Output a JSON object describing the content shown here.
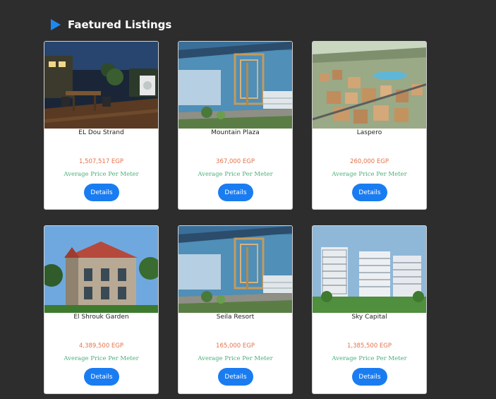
{
  "header": {
    "title": "Faetured Listings",
    "icon": "play-triangle-icon",
    "accent": "#1e88f0"
  },
  "colors": {
    "price": "#e4734a",
    "avg": "#4cae7a",
    "button": "#1a7cf1",
    "background": "#2d2d2d"
  },
  "listings": [
    {
      "name": "EL Dou Strand",
      "price": "1,507,517 EGP",
      "avg_label": "Average Price Per Meter",
      "button": "Details"
    },
    {
      "name": "Mountain Plaza",
      "price": "367,000 EGP",
      "avg_label": "Average Price Per Meter",
      "button": "Details"
    },
    {
      "name": "Laspero",
      "price": "260,000 EGP",
      "avg_label": "Average Price Per Meter",
      "button": "Details"
    },
    {
      "name": "El Shrouk Garden",
      "price": "4,389,500 EGP",
      "avg_label": "Average Price Per Meter",
      "button": "Details"
    },
    {
      "name": "Seila Resort",
      "price": "165,000 EGP",
      "avg_label": "Average Price Per Meter",
      "button": "Details"
    },
    {
      "name": "Sky Capital",
      "price": "1,385,500 EGP",
      "avg_label": "Average Price Per Meter",
      "button": "Details"
    }
  ]
}
